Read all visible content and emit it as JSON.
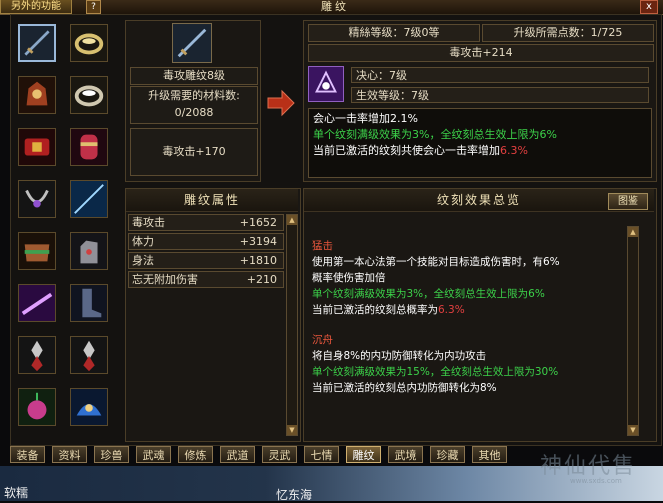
{
  "window": {
    "title": "雕纹",
    "left_tab": "另外的功能",
    "help": "?",
    "close": "x"
  },
  "item": {
    "name": "毒攻雕纹8级",
    "material_label": "升级需要的材料数:",
    "material_value": "0/2088",
    "attribute": "毒攻击+170"
  },
  "right": {
    "level": "精絲等级：7级0等",
    "points": "升级所需点数：1/725",
    "current_attr": "毒攻击+214",
    "skill_name": "决心：7级",
    "effect_level": "生效等级：7级",
    "desc_line1": "会心一击率增加2.1%",
    "desc_line2": "单个纹刻满级效果为3%，全纹刻总生效上限为6%",
    "desc_line3_prefix": "当前已激活的纹刻共使会心一击率增加",
    "desc_line3_value": "6.3%"
  },
  "attr_panel": {
    "title": "雕纹属性",
    "rows": [
      {
        "key": "毒攻击",
        "value": "+1652"
      },
      {
        "key": "体力",
        "value": "+3194"
      },
      {
        "key": "身法",
        "value": "+1810"
      },
      {
        "key": "忘无附加伤害",
        "value": "+210"
      }
    ]
  },
  "overview": {
    "title": "纹刻效果总览",
    "button": "图鉴",
    "s1_title": "猛击",
    "s1_l1": "使用第一本心法第一个技能对目标造成伤害时，有6%",
    "s1_l2": "概率使伤害加倍",
    "s1_l3": "单个纹刻满级效果为3%，全纹刻总生效上限为6%",
    "s1_l4_prefix": "当前已激活的纹刻总概率为",
    "s1_l4_value": "6.3%",
    "s2_title": "沉舟",
    "s2_l1": "将自身8%的内功防御转化为内功攻击",
    "s2_l2": "单个纹刻满级效果为15%，全纹刻总生效上限为30%",
    "s2_l3": "当前已激活的纹刻总内功防御转化为8%"
  },
  "tabs": [
    "装备",
    "资料",
    "珍兽",
    "武魂",
    "修炼",
    "武道",
    "灵武",
    "七情",
    "雕纹",
    "武境",
    "珍藏",
    "其他"
  ],
  "active_tab": "雕纹",
  "world": {
    "name1": "软糯",
    "name2": "忆东海"
  },
  "logo": {
    "text": "神仙代售",
    "url": "www.sxds.com"
  },
  "colors": {
    "green": "#3cd24a",
    "red": "#e34040",
    "title_red": "#e8563c",
    "gold": "#f0e2b8"
  }
}
